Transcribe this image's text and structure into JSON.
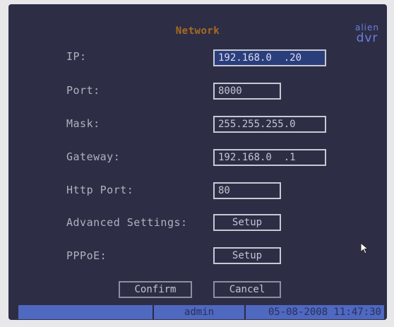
{
  "title": "Network",
  "logo": {
    "line1": "alien",
    "line2": "dvr"
  },
  "fields": [
    {
      "label": "IP:",
      "value": "192.168.0  .20"
    },
    {
      "label": "Port:",
      "value": "8000"
    },
    {
      "label": "Mask:",
      "value": "255.255.255.0"
    },
    {
      "label": "Gateway:",
      "value": "192.168.0  .1"
    },
    {
      "label": "Http Port:",
      "value": "80"
    }
  ],
  "advanced": {
    "label": "Advanced Settings:",
    "button": "Setup"
  },
  "pppoe": {
    "label": "PPPoE:",
    "button": "Setup"
  },
  "buttons": {
    "confirm": "Confirm",
    "cancel": "Cancel"
  },
  "status": {
    "user": "admin",
    "datetime": "05-08-2008 11:47:30"
  },
  "colors": {
    "background": "#2d2e46",
    "title": "#a86a1e",
    "statusbar": "#4f68c0",
    "selected": "#2a3e7c"
  }
}
